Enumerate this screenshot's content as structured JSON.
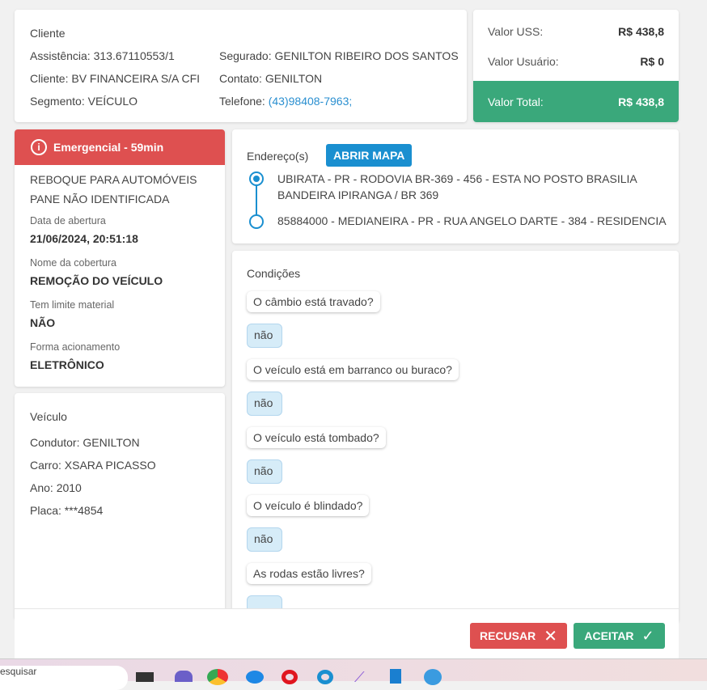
{
  "cliente": {
    "title": "Cliente",
    "assistencia": "Assistência: 313.67110553/1",
    "cliente": "Cliente: BV FINANCEIRA S/A CFI",
    "segmento": "Segmento: VEÍCULO",
    "segurado": "Segurado: GENILTON RIBEIRO DOS SANTOS",
    "contato": "Contato: GENILTON",
    "telefone_label": "Telefone:",
    "telefone": "(43)98408-7963;"
  },
  "valores": {
    "uss_label": "Valor USS:",
    "uss": "R$ 438,8",
    "usuario_label": "Valor Usuário:",
    "usuario": "R$ 0",
    "total_label": "Valor Total:",
    "total": "R$ 438,8"
  },
  "servico": {
    "badge": "Emergencial - 59min",
    "tipo": "REBOQUE PARA AUTOMÓVEIS",
    "problema": "PANE NÃO IDENTIFICADA",
    "data_label": "Data de abertura",
    "data": "21/06/2024, 20:51:18",
    "cobertura_label": "Nome da cobertura",
    "cobertura": "REMOÇÃO DO VEÍCULO",
    "limite_label": "Tem limite material",
    "limite": "NÃO",
    "forma_label": "Forma acionamento",
    "forma": "ELETRÔNICO"
  },
  "veiculo": {
    "title": "Veículo",
    "condutor": "Condutor: GENILTON",
    "carro": "Carro: XSARA PICASSO",
    "ano": "Ano: 2010",
    "placa": "Placa: ***4854"
  },
  "enderecos": {
    "title": "Endereço(s)",
    "map_button": "ABRIR MAPA",
    "origem": "UBIRATA - PR - RODOVIA BR-369 - 456 - ESTA NO POSTO BRASILIA BANDEIRA IPIRANGA / BR 369",
    "destino": "85884000 - MEDIANEIRA - PR - RUA ANGELO DARTE - 384 - RESIDENCIA"
  },
  "condicoes": {
    "title": "Condições",
    "items": [
      {
        "q": "O câmbio está travado?",
        "a": "não"
      },
      {
        "q": "O veículo está em barranco ou buraco?",
        "a": "não"
      },
      {
        "q": "O veículo está tombado?",
        "a": "não"
      },
      {
        "q": "O veículo é blindado?",
        "a": "não"
      },
      {
        "q": "As rodas estão livres?",
        "a": ""
      }
    ]
  },
  "actions": {
    "recusar": "RECUSAR",
    "aceitar": "ACEITAR"
  },
  "taskbar": {
    "search": "Pesquisar"
  },
  "colors": {
    "green": "#3aa87b",
    "red": "#de5050",
    "blue": "#1a8fd0"
  }
}
